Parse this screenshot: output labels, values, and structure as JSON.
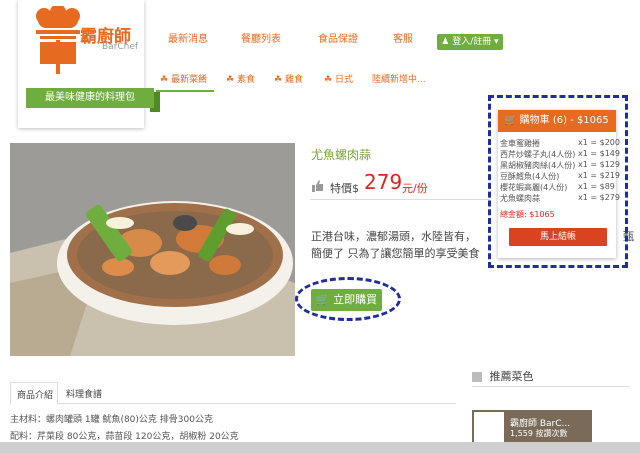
{
  "brand": {
    "logo_text": "霸廚師",
    "logo_sub": "BarChef",
    "tagline": "最美味健康的料理包"
  },
  "topnav": [
    "最新消息",
    "餐廳列表",
    "食品保證",
    "客服"
  ],
  "login_label": "登入/註冊",
  "subnav": [
    "最新菜餚",
    "素食",
    "雞食",
    "日式",
    "陸續新增中..."
  ],
  "product": {
    "title": "尤魚螺肉蒜",
    "price_label": "特價$",
    "price": "279",
    "unit": "元/份",
    "desc_line1": "正港台味，濃郁湯頭，水陸皆有，",
    "desc_line1_end": "甄",
    "desc_line2": "簡便了 只為了讓您簡單的享受美食",
    "buy_label": "立即購買"
  },
  "cart": {
    "header": "購物車 (6) - $1065",
    "items": [
      {
        "name": "金車蜜雞捲",
        "qty": "x1 = $200"
      },
      {
        "name": "西芹炒螺子丸(4人份)",
        "qty": "x1 = $149"
      },
      {
        "name": "黑胡椒豬肉絲(4人份)",
        "qty": "x1 = $129"
      },
      {
        "name": "豆酥鱈魚(4人份)",
        "qty": "x1 = $219"
      },
      {
        "name": "櫻花蝦高麗(4人份)",
        "qty": "x1 = $89"
      },
      {
        "name": "尤魚螺肉蒜",
        "qty": "x1 = $279"
      }
    ],
    "total": "總金額: $1065",
    "checkout_label": "馬上結帳"
  },
  "tabs": [
    "商品介紹",
    "料理食譜"
  ],
  "ingredients": {
    "line1": "主材料：螺肉罐頭 1罐 魷魚(80)公克 排骨300公克",
    "line2": "配料：芹菜段 80公克，蒜苗段 120公克，胡椒粉 20公克"
  },
  "recommend": {
    "title": "推薦菜色",
    "card_label": "霸廚師 BarC...",
    "card_sub": "1,559 按讚次數"
  },
  "colors": {
    "orange": "#e66a1f",
    "green": "#6fae3e",
    "red": "#d9261c",
    "annotation_blue": "#1f2d9e"
  }
}
